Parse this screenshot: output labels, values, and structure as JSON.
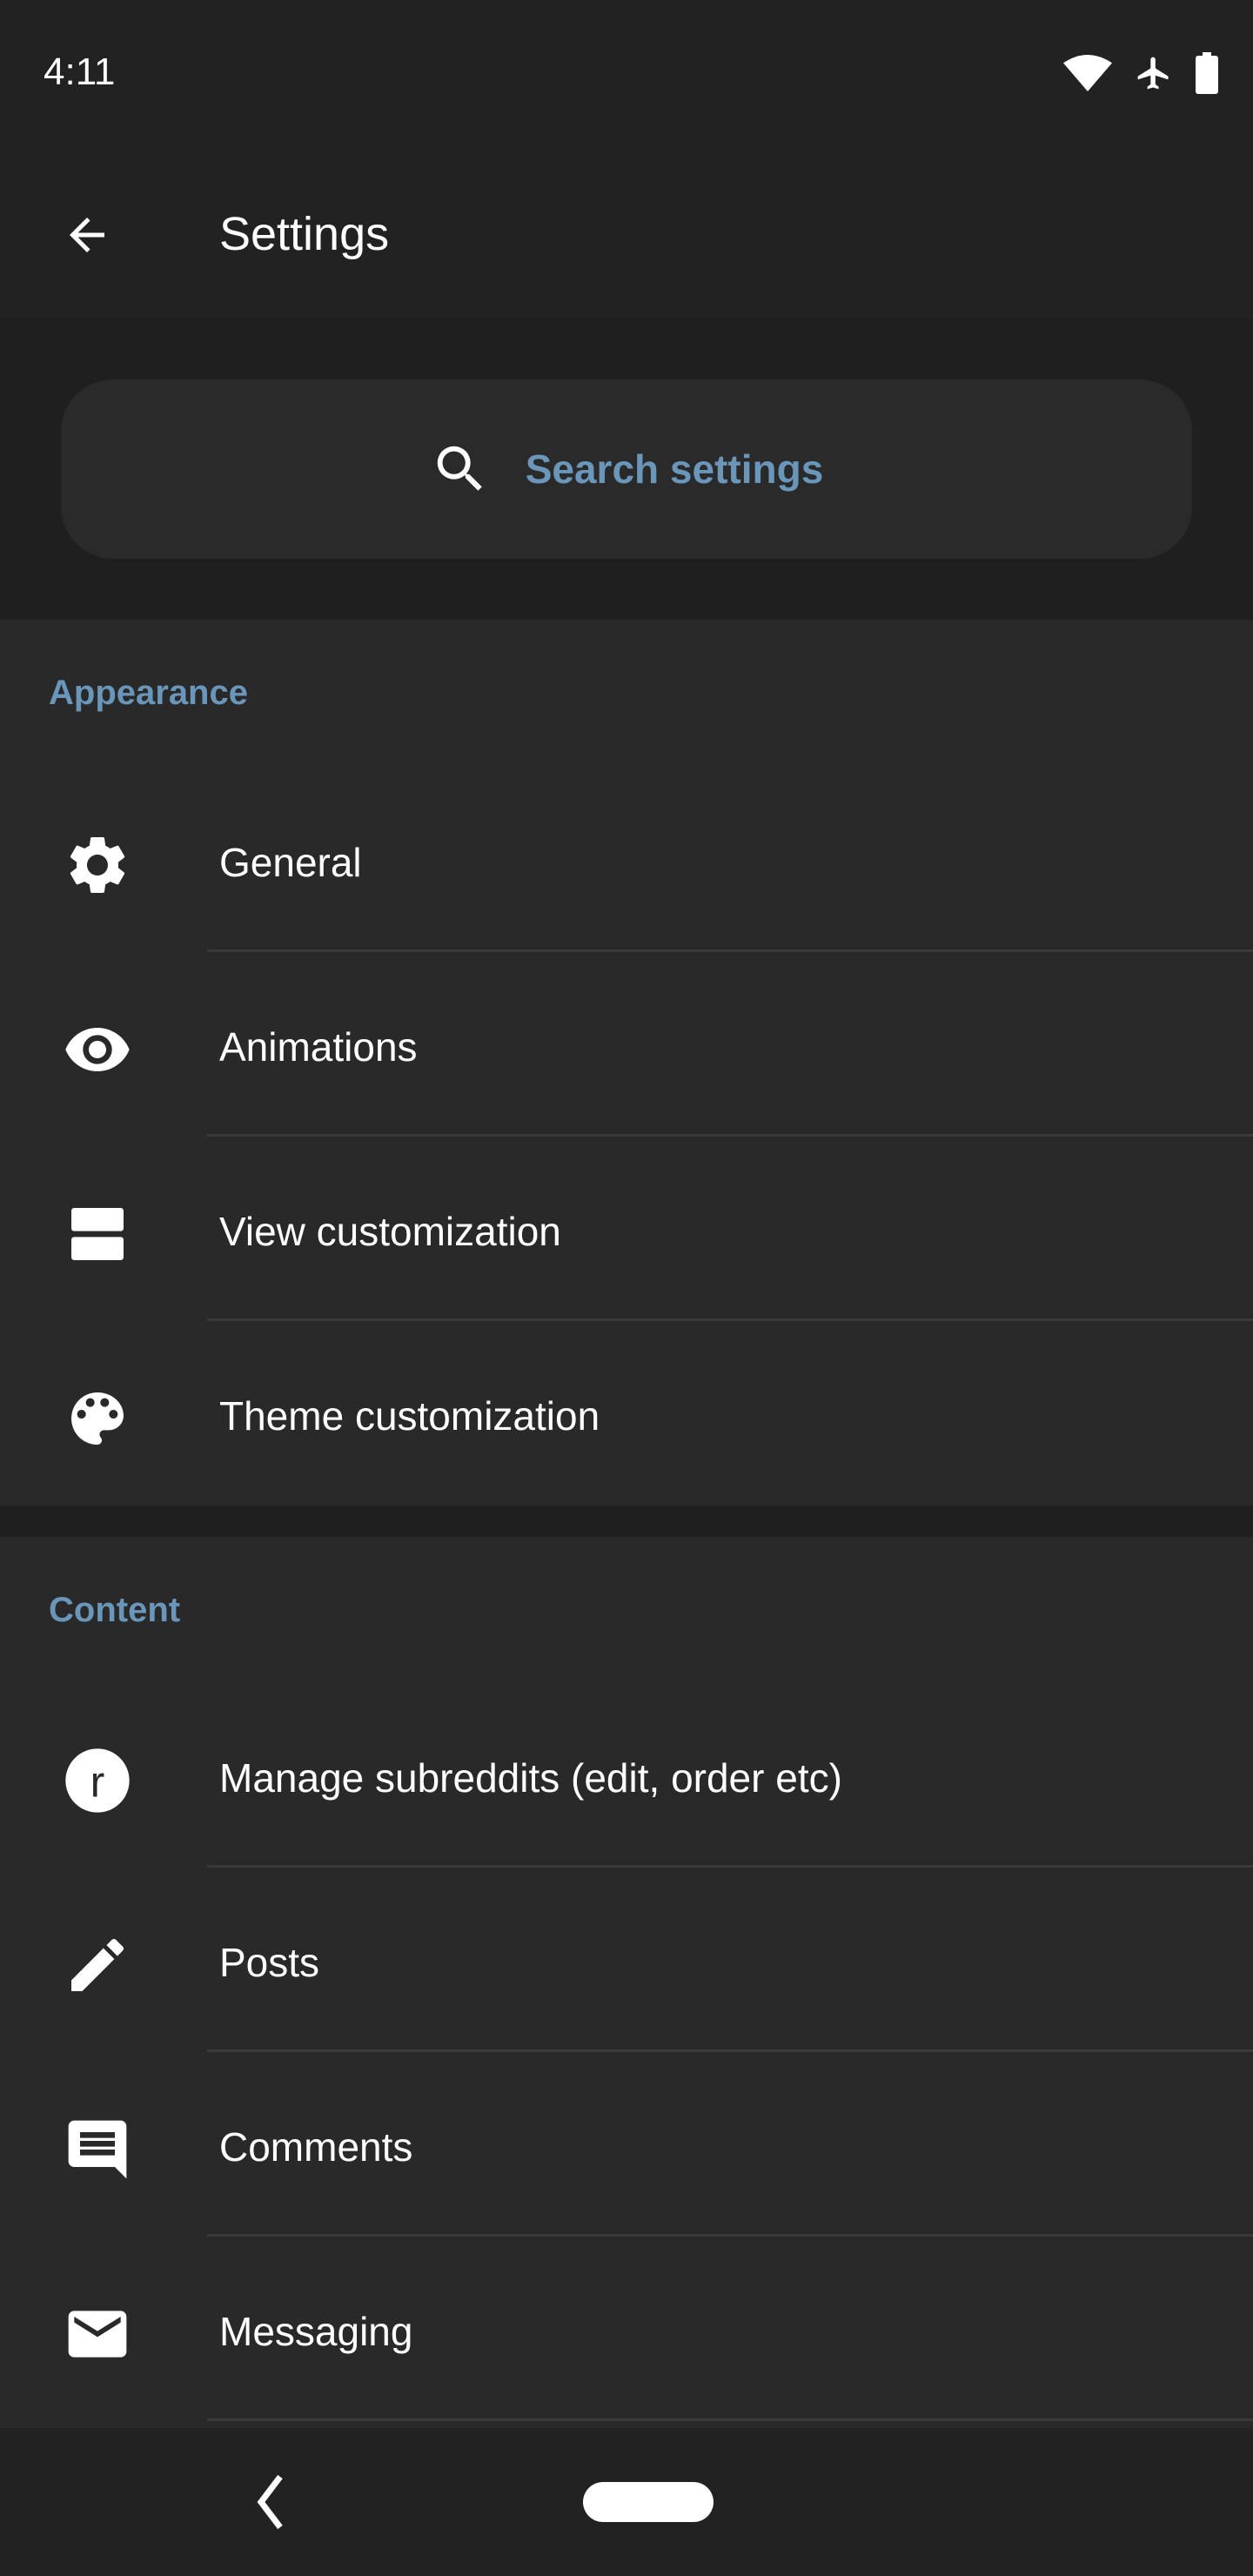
{
  "status_bar": {
    "time": "4:11",
    "icons": [
      "wifi-icon",
      "airplane-mode-icon",
      "battery-icon"
    ]
  },
  "app_bar": {
    "title": "Settings",
    "back_icon": "arrow-back-icon"
  },
  "search": {
    "placeholder": "Search settings",
    "icon": "search-icon"
  },
  "colors": {
    "accent": "#6a96b9",
    "background": "#292929",
    "bar": "#222222"
  },
  "sections": [
    {
      "header": "Appearance",
      "items": [
        {
          "label": "General",
          "icon": "gear-icon"
        },
        {
          "label": "Animations",
          "icon": "eye-icon"
        },
        {
          "label": "View customization",
          "icon": "view-agenda-icon"
        },
        {
          "label": "Theme customization",
          "icon": "palette-icon"
        }
      ]
    },
    {
      "header": "Content",
      "items": [
        {
          "label": "Manage subreddits (edit, order etc)",
          "icon": "reddit-icon"
        },
        {
          "label": "Posts",
          "icon": "pencil-icon"
        },
        {
          "label": "Comments",
          "icon": "comment-icon"
        },
        {
          "label": "Messaging",
          "icon": "mail-icon"
        }
      ]
    }
  ],
  "nav_bar": {
    "back": "nav-back-icon",
    "home": "home-pill"
  }
}
